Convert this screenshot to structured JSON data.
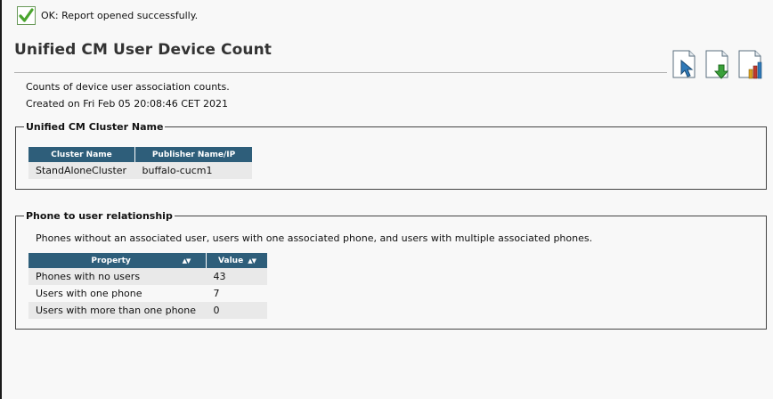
{
  "status": {
    "message": "OK: Report opened successfully."
  },
  "page": {
    "title": "Unified CM User Device Count",
    "description": "Counts of device user association counts.",
    "created": "Created on Fri Feb 05 20:08:46 CET 2021"
  },
  "toolbar": {
    "icons": [
      "view-report-icon",
      "download-report-icon",
      "chart-report-icon"
    ]
  },
  "cluster_section": {
    "legend": "Unified CM Cluster Name",
    "columns": [
      "Cluster Name",
      "Publisher Name/IP"
    ],
    "rows": [
      [
        "StandAloneCluster",
        "buffalo-cucm1"
      ]
    ]
  },
  "relationship_section": {
    "legend": "Phone to user relationship",
    "description": "Phones without an associated user, users with one associated phone, and users with multiple associated phones.",
    "columns": [
      "Property",
      "Value"
    ],
    "sort_glyph": "▲▼",
    "rows": [
      [
        "Phones with no users",
        "43"
      ],
      [
        "Users with one phone",
        "7"
      ],
      [
        "Users with more than one phone",
        "0"
      ]
    ]
  },
  "colors": {
    "header_bg": "#2e5e7a",
    "ok_green": "#4aa52e",
    "row_alt": "#e9e9e9"
  }
}
